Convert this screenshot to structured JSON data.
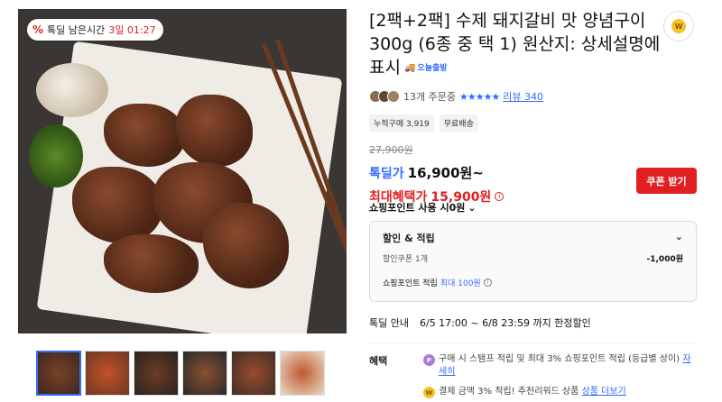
{
  "timer": {
    "icon": "percent-icon",
    "label": "톡딜 남은시간",
    "value": "3일 01:27"
  },
  "product": {
    "title": "[2팩+2팩] 수제 돼지갈비 맛 양념구이 300g (6종 중 택 1) 원산지: 상세설명에 표시",
    "delivery_badge": "오늘출발"
  },
  "rating": {
    "order_count": "13개 주문중",
    "stars": "★★★★★",
    "review_link": "리뷰 340"
  },
  "tags": [
    "누적구매 3,919",
    "무료배송"
  ],
  "price": {
    "original": "27,900원",
    "deal_label": "톡딜가",
    "deal_value": "16,900원~",
    "max_label": "최대혜택가",
    "max_value": "15,900원",
    "coupon_button": "쿠폰 받기",
    "points_label": "쇼핑포인트 사용 시0원"
  },
  "discount": {
    "header": "할인 & 적립",
    "coupon_label": "할인쿠폰 1개",
    "coupon_amount": "-1,000원",
    "points_prefix": "쇼핑포인트 적립",
    "points_highlight": "최대 100원"
  },
  "deal_info": {
    "label": "톡딜 안내",
    "text": "6/5 17:00 ~ 6/8 23:59 까지 한정할인"
  },
  "benefit": {
    "label": "혜택",
    "item1_text": "구매 시 스탬프 적립 및 최대 3% 쇼핑포인트 적립 (등급별 상이)",
    "item1_link": "자세히",
    "item2_text": "결제 금액 3% 적립! 추천리워드 상품",
    "item2_link": "상품 더보기"
  },
  "colors": {
    "accent_blue": "#346aff",
    "accent_red": "#e02020"
  }
}
